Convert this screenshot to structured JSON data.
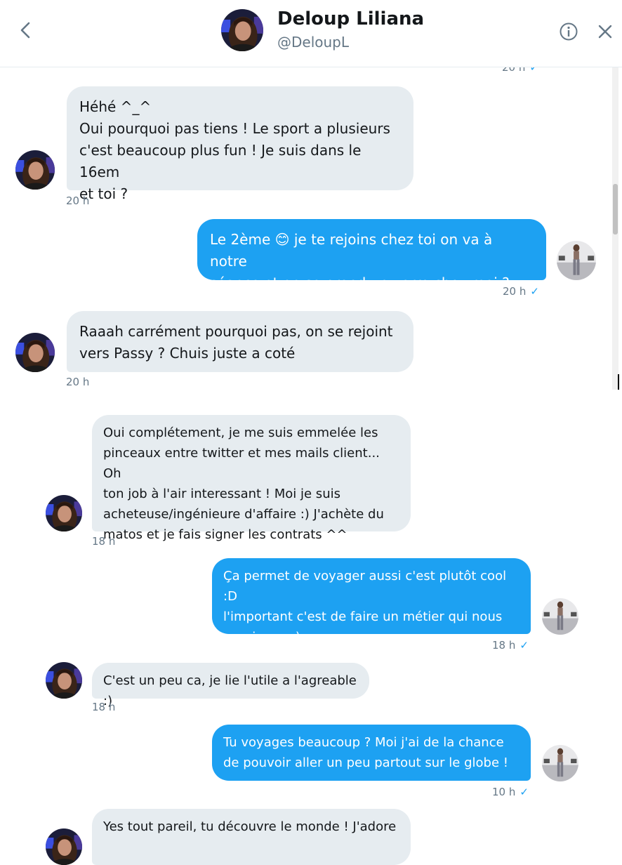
{
  "header": {
    "name": "Deloup Liliana",
    "handle": "@DeloupL",
    "back_icon": "chevron-left-icon",
    "info_icon": "info-circle-icon",
    "close_icon": "close-icon",
    "top_timestamp": "20 h"
  },
  "colors": {
    "outgoing": "#1da1f2",
    "incoming": "#e6ecf0",
    "timestamp": "#657786"
  },
  "messages": [
    {
      "direction": "in",
      "text": "Héhé ^_^\nOui pourquoi pas tiens ! Le sport a plusieurs\nc'est beaucoup plus fun ! Je suis dans le 16em\net toi ?",
      "time": "20 h"
    },
    {
      "direction": "out",
      "text_before": "Le 2ème ",
      "emoji": "😊",
      "text_after": " je te rejoins chez toi on va à notre\nséance et on se prend un verre chez-moi ?",
      "time": "20 h",
      "seen": "✓"
    },
    {
      "direction": "in",
      "text": "Raaah carrément pourquoi pas, on se rejoint\nvers Passy ? Chuis juste a coté",
      "time": "20 h"
    },
    {
      "direction": "in",
      "text": "Oui complétement, je me suis emmelée les\npinceaux entre twitter et mes mails client... Oh\nton job à l'air interessant ! Moi je suis\nacheteuse/ingénieure d'affaire :) J'achète du\nmatos et je fais signer les contrats ^^",
      "time": "18 h"
    },
    {
      "direction": "out",
      "text": "Ça permet de voyager aussi c'est plutôt cool :D\nl'important c'est de faire un métier qui nous\npassionne :)",
      "time": "18 h",
      "seen": "✓"
    },
    {
      "direction": "in",
      "text": "C'est un peu ca, je lie l'utile a l'agreable :)",
      "time": "18 h"
    },
    {
      "direction": "out",
      "text": "Tu voyages beaucoup ? Moi j'ai de la chance\nde pouvoir aller un peu partout sur le globe !",
      "time": "10 h",
      "seen": "✓"
    },
    {
      "direction": "in",
      "text": "Yes tout pareil, tu découvre le monde ! J'adore"
    }
  ]
}
